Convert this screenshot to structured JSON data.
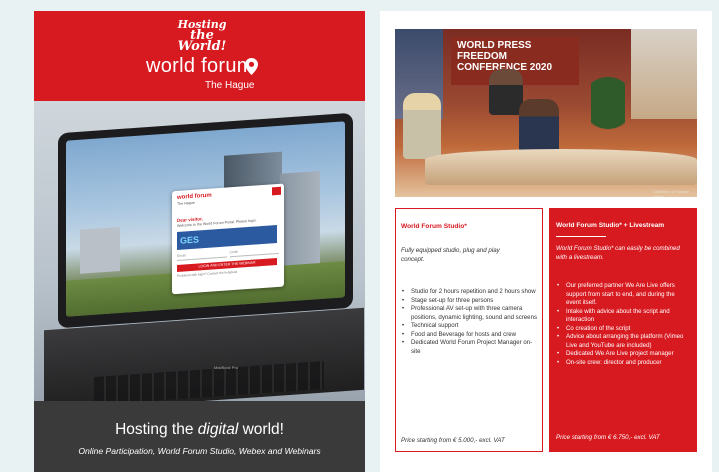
{
  "left_brochure": {
    "logo_top_line1": "Hosting",
    "logo_top_line2": "the World!",
    "logo_main": "world forum",
    "logo_sub": "The Hague",
    "login_dialog": {
      "logo": "world forum",
      "logo_sub": "The Hague",
      "greeting": "Dear visitor,",
      "intro": "Welcome to the World Forum Portal. Please login.",
      "ges_label": "GES",
      "name_placeholder": "Email",
      "code_placeholder": "Code",
      "button_label": "LOGIN AND ENTER THE WEBINAR",
      "help_link": "Problems with login? Contact the helpdesk"
    },
    "laptop_label": "MacBook Pro",
    "headline_before": "Hosting the ",
    "headline_em": "digital",
    "headline_after": " world!",
    "subline": "Online Participation, World Forum Studio, Webex and Webinars"
  },
  "right_brochure": {
    "photo_banner": "WORLD PRESS FREEDOM CONFERENCE 2020",
    "photo_credit": "©Ministry of Foreign Affairs",
    "studio_box": {
      "title": "World Forum Studio*",
      "intro": "Fully equipped studio, plug and play concept.",
      "items": [
        "Studio for 2 hours repetition and 2 hours show",
        "Stage set-up for three persons",
        "Professional AV set-up with three camera positions, dynamic lighting, sound and screens",
        "Technical support",
        "Food and Beverage for hosts and crew",
        "Dedicated World Forum Project Manager on-site"
      ],
      "price": "Price starting from € 5.000,- excl. VAT"
    },
    "livestream_box": {
      "title": "World Forum Studio* + Livestream",
      "intro": "World Forum Studio* can easily be combined with a livestream.",
      "items": [
        "Our preferred partner We Are Live offers support from start to end, and during the event itself.",
        "Intake with advice about the script and interaction",
        "Co creation of the script",
        "Advice about arranging the platform (Vimeo Live and YouTube are included)",
        "Dedicated We Are Live project manager",
        "On-site crew: director and producer"
      ],
      "price": "Price starting from € 6.750,- excl. VAT"
    }
  },
  "colors": {
    "brand_red": "#d71920",
    "footer_dark": "#3a3a3a",
    "background": "#e8f2f3"
  }
}
